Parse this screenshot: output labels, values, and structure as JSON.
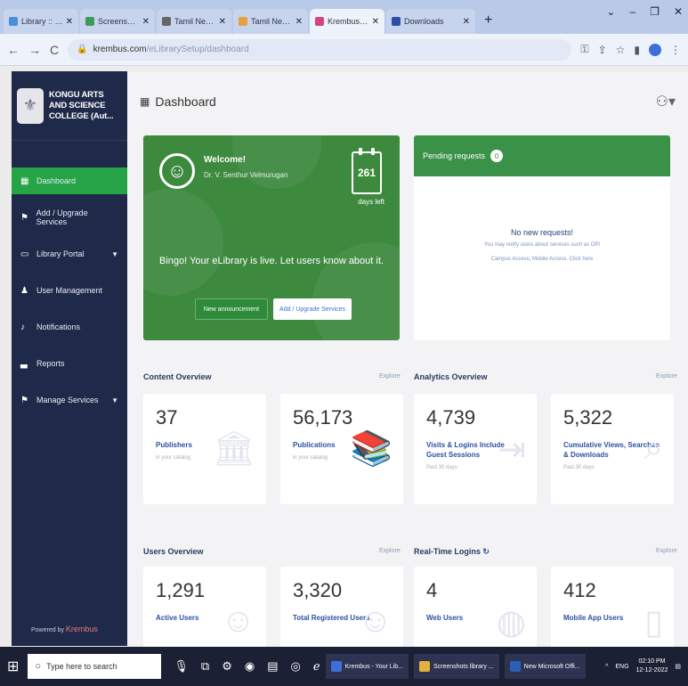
{
  "browser": {
    "tabs": [
      {
        "label": "Library :: Home Page",
        "color": "#4a90d9",
        "active": false
      },
      {
        "label": "Screenshots - reg",
        "color": "#3d9a5c",
        "active": false
      },
      {
        "label": "Tamil News Latest Ta",
        "color": "#666",
        "active": false
      },
      {
        "label": "Tamil News | Online",
        "color": "#e5a13c",
        "active": false
      },
      {
        "label": "Krembus - Your Libr",
        "color": "#d6457a",
        "active": true
      },
      {
        "label": "Downloads",
        "color": "#2e4fa6",
        "active": false
      }
    ],
    "url_domain": "krembus.com",
    "url_path": "/eLibrarySetup/dashboard"
  },
  "sidebar": {
    "institution": [
      "KONGU ARTS",
      "AND SCIENCE",
      "COLLEGE (Aut..."
    ],
    "items": [
      {
        "label": "Dashboard",
        "icon": "dashboard-icon",
        "active": true
      },
      {
        "label": "Add / Upgrade Services",
        "icon": "flag-icon",
        "active": false
      },
      {
        "label": "Library Portal",
        "icon": "monitor-icon",
        "active": false,
        "caret": true
      },
      {
        "label": "User Management",
        "icon": "user-icon",
        "active": false
      },
      {
        "label": "Notifications",
        "icon": "bell-icon",
        "active": false
      },
      {
        "label": "Reports",
        "icon": "chart-icon",
        "active": false
      },
      {
        "label": "Manage Services",
        "icon": "flag-icon",
        "active": false,
        "caret": true
      }
    ],
    "powered_prefix": "Powered by",
    "powered_brand": "Krembus"
  },
  "header": {
    "title": "Dashboard"
  },
  "welcome": {
    "greeting": "Welcome!",
    "name": "Dr. V. Senthur Velmurugan",
    "days": "261",
    "days_label": "days left",
    "message": "Bingo! Your eLibrary is live. Let users know about it.",
    "new_announcement": "New announcement",
    "add_upgrade": "Add / Upgrade Services"
  },
  "pending": {
    "title": "Pending requests",
    "count": "0",
    "none": "No new requests!",
    "desc1": "You may notify users about services such as OPI",
    "desc2": "Campus Access, Mobile Access. Click here"
  },
  "content_overview": {
    "title": "Content Overview",
    "explore": "Explore",
    "cards": [
      {
        "value": "37",
        "label": "Publishers",
        "sub": "in your catalog"
      },
      {
        "value": "56,173",
        "label": "Publications",
        "sub": "in your catalog"
      }
    ]
  },
  "analytics_overview": {
    "title": "Analytics Overview",
    "explore": "Explore",
    "cards": [
      {
        "value": "4,739",
        "label": "Visits & Logins Include Guest Sessions",
        "sub": "Past 30 days"
      },
      {
        "value": "5,322",
        "label": "Cumulative Views, Searches & Downloads",
        "sub": "Past 30 days"
      }
    ]
  },
  "users_overview": {
    "title": "Users Overview",
    "explore": "Explore",
    "cards": [
      {
        "value": "1,291",
        "label": "Active Users"
      },
      {
        "value": "3,320",
        "label": "Total Registered Users"
      }
    ]
  },
  "realtime": {
    "title": "Real-Time Logins",
    "explore": "Explore",
    "cards": [
      {
        "value": "4",
        "label": "Web Users"
      },
      {
        "value": "412",
        "label": "Mobile App Users"
      }
    ]
  },
  "taskbar": {
    "search_placeholder": "Type here to search",
    "apps": [
      "Krembus - Your Lib...",
      "Screenshots library ...",
      "New Microsoft Offi..."
    ],
    "lang": "ENG",
    "time": "02:10 PM",
    "date": "12-12-2022"
  }
}
